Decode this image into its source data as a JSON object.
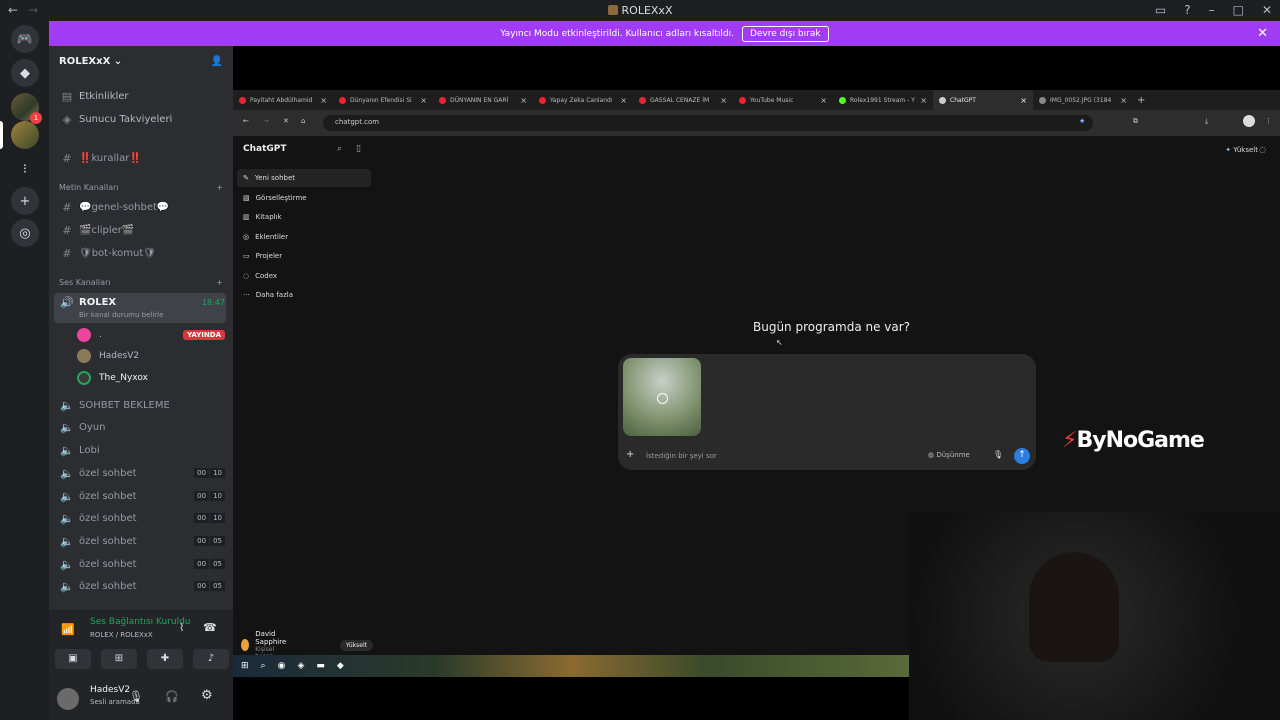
{
  "window": {
    "title": "ROLEXxX"
  },
  "banner": {
    "text": "Yayıncı Modu etkinleştirildi. Kullanıcı adları kısaltıldı.",
    "button": "Devre dışı bırak"
  },
  "server": {
    "name": "ROLEXxX"
  },
  "menu": {
    "events": "Etkinlikler",
    "boosts": "Sunucu Takviyeleri",
    "rules": "‼️kurallar‼️"
  },
  "text_category": "Metin Kanalları",
  "text_channels": [
    "💬genel-sohbet💬",
    "🎬clipler🎬",
    "🛡bot-komut🛡"
  ],
  "voice_category": "Ses Kanalları",
  "active_voice": {
    "name": "ROLEX",
    "time": "18:47",
    "status": "Bir kanal durumu belirle"
  },
  "voice_users": [
    {
      "name": ".",
      "live": "YAYINDA"
    },
    {
      "name": "HadesV2"
    },
    {
      "name": "The_Nyxox"
    }
  ],
  "voice_channels": [
    {
      "name": "SOHBET BEKLEME"
    },
    {
      "name": "Oyun"
    },
    {
      "name": "Lobi"
    },
    {
      "name": "özel sohbet",
      "a": "00",
      "b": "10"
    },
    {
      "name": "özel sohbet",
      "a": "00",
      "b": "10"
    },
    {
      "name": "özel sohbet",
      "a": "00",
      "b": "10"
    },
    {
      "name": "özel sohbet",
      "a": "00",
      "b": "05"
    },
    {
      "name": "özel sohbet",
      "a": "00",
      "b": "05"
    },
    {
      "name": "özel sohbet",
      "a": "00",
      "b": "05"
    }
  ],
  "voice_status": {
    "title": "Ses Bağlantısı Kuruldu",
    "sub": "ROLEX / ROLEXxX"
  },
  "user": {
    "name": "HadesV2",
    "status": "Sesli aramada"
  },
  "browser": {
    "tabs": [
      "Payitaht Abdülhamid",
      "Dünyanın Efendisi Si",
      "DÜNYANIN EN GARİ",
      "Yapay Zeka Canlandı",
      "GASSAL CENAZE İM",
      "YouTube Music",
      "Rolex1991 Stream - Y",
      "ChatGPT",
      "IMG_0052.JPG (3184"
    ],
    "url": "chatgpt.com"
  },
  "chatgpt": {
    "brand": "ChatGPT",
    "upgrade": "Yükselt",
    "nav": [
      "Yeni sohbet",
      "Görselleştirme",
      "Kitaplık",
      "Eklentiler",
      "Projeler",
      "Codex",
      "Daha fazla"
    ],
    "headline": "Bugün programda ne var?",
    "placeholder": "İstediğin bir şeyi sor",
    "think": "Düşünme",
    "account_name": "David Sapphire",
    "account_type": "Kişisel hesap",
    "account_button": "Yükselt"
  },
  "overlay_logo": "ByNoGame"
}
